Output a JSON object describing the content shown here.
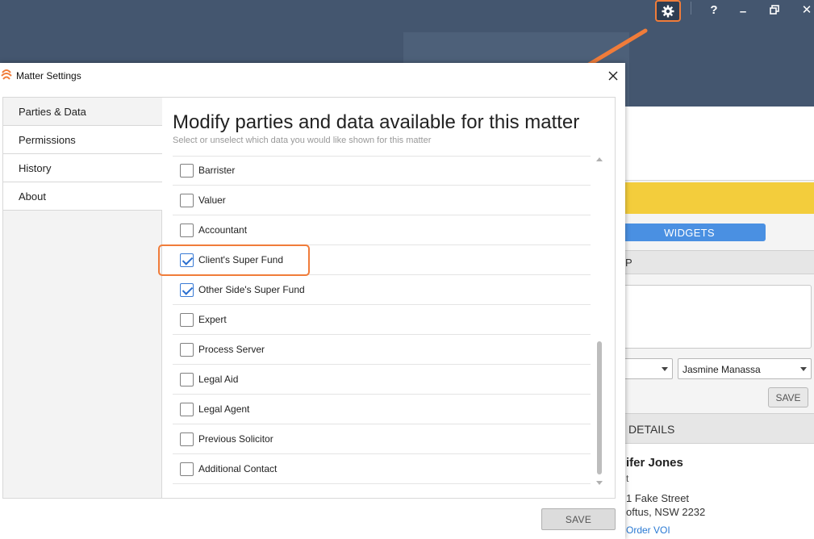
{
  "window": {
    "help_label": "?",
    "minimize_label": "–",
    "close_label": "✕",
    "gear_icon": "gear-icon",
    "highlight_color": "#f07c3a"
  },
  "background": {
    "widgets_label": "WIDGETS",
    "strip_label": "P",
    "select_value": "Jasmine Manassa",
    "save_label": "SAVE",
    "details_label": "DETAILS",
    "contact_name": "ifer Jones",
    "contact_sub": "t",
    "address_line1": "1 Fake Street",
    "address_line2": "oftus, NSW 2232",
    "link_label": "Order VOI"
  },
  "dialog": {
    "title": "Matter Settings",
    "heading": "Modify parties and data available for this matter",
    "subheading": "Select or unselect which data you would like shown for this matter",
    "save_label": "SAVE",
    "sidebar": [
      {
        "label": "Parties & Data",
        "active": true
      },
      {
        "label": "Permissions",
        "active": false
      },
      {
        "label": "History",
        "active": false
      },
      {
        "label": "About",
        "active": false
      }
    ],
    "items": [
      {
        "label": "Barrister",
        "checked": false
      },
      {
        "label": "Valuer",
        "checked": false
      },
      {
        "label": "Accountant",
        "checked": false
      },
      {
        "label": "Client's Super Fund",
        "checked": true
      },
      {
        "label": "Other Side's Super Fund",
        "checked": true
      },
      {
        "label": "Expert",
        "checked": false
      },
      {
        "label": "Process Server",
        "checked": false
      },
      {
        "label": "Legal Aid",
        "checked": false
      },
      {
        "label": "Legal Agent",
        "checked": false
      },
      {
        "label": "Previous Solicitor",
        "checked": false
      },
      {
        "label": "Additional Contact",
        "checked": false
      }
    ]
  }
}
